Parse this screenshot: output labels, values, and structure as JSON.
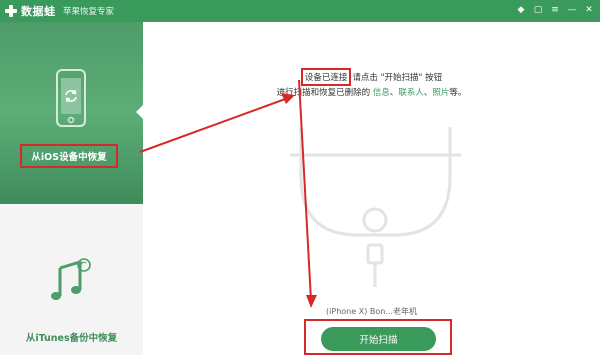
{
  "titlebar": {
    "app_name": "数据蛙",
    "subtitle": "苹果恢复专家",
    "icons": [
      "diamond-icon",
      "chat-icon",
      "menu-icon",
      "minimize-icon",
      "close-icon"
    ],
    "bg_color": "#3a9a5c"
  },
  "sidebar": {
    "items": [
      {
        "label": "从iOS设备中恢复",
        "icon": "phone-restore-icon",
        "active": true
      },
      {
        "label": "从iTunes备份中恢复",
        "icon": "music-note-icon",
        "active": false
      }
    ]
  },
  "main": {
    "instruction": {
      "connected": "设备已连接",
      "line1_rest": "请点击 \"开始扫描\" 按钮",
      "line2_prefix": "进行扫描和恢复已删除的",
      "info": "信息",
      "sep1": "、",
      "contacts": "联系人",
      "sep2": "、",
      "photos": "照片",
      "line2_suffix": "等。"
    },
    "device_name": "(iPhone X) Bon...老年机",
    "start_button": "开始扫描"
  },
  "colors": {
    "accent_green": "#3a9a5c",
    "annotation_red": "#d62a2a"
  }
}
